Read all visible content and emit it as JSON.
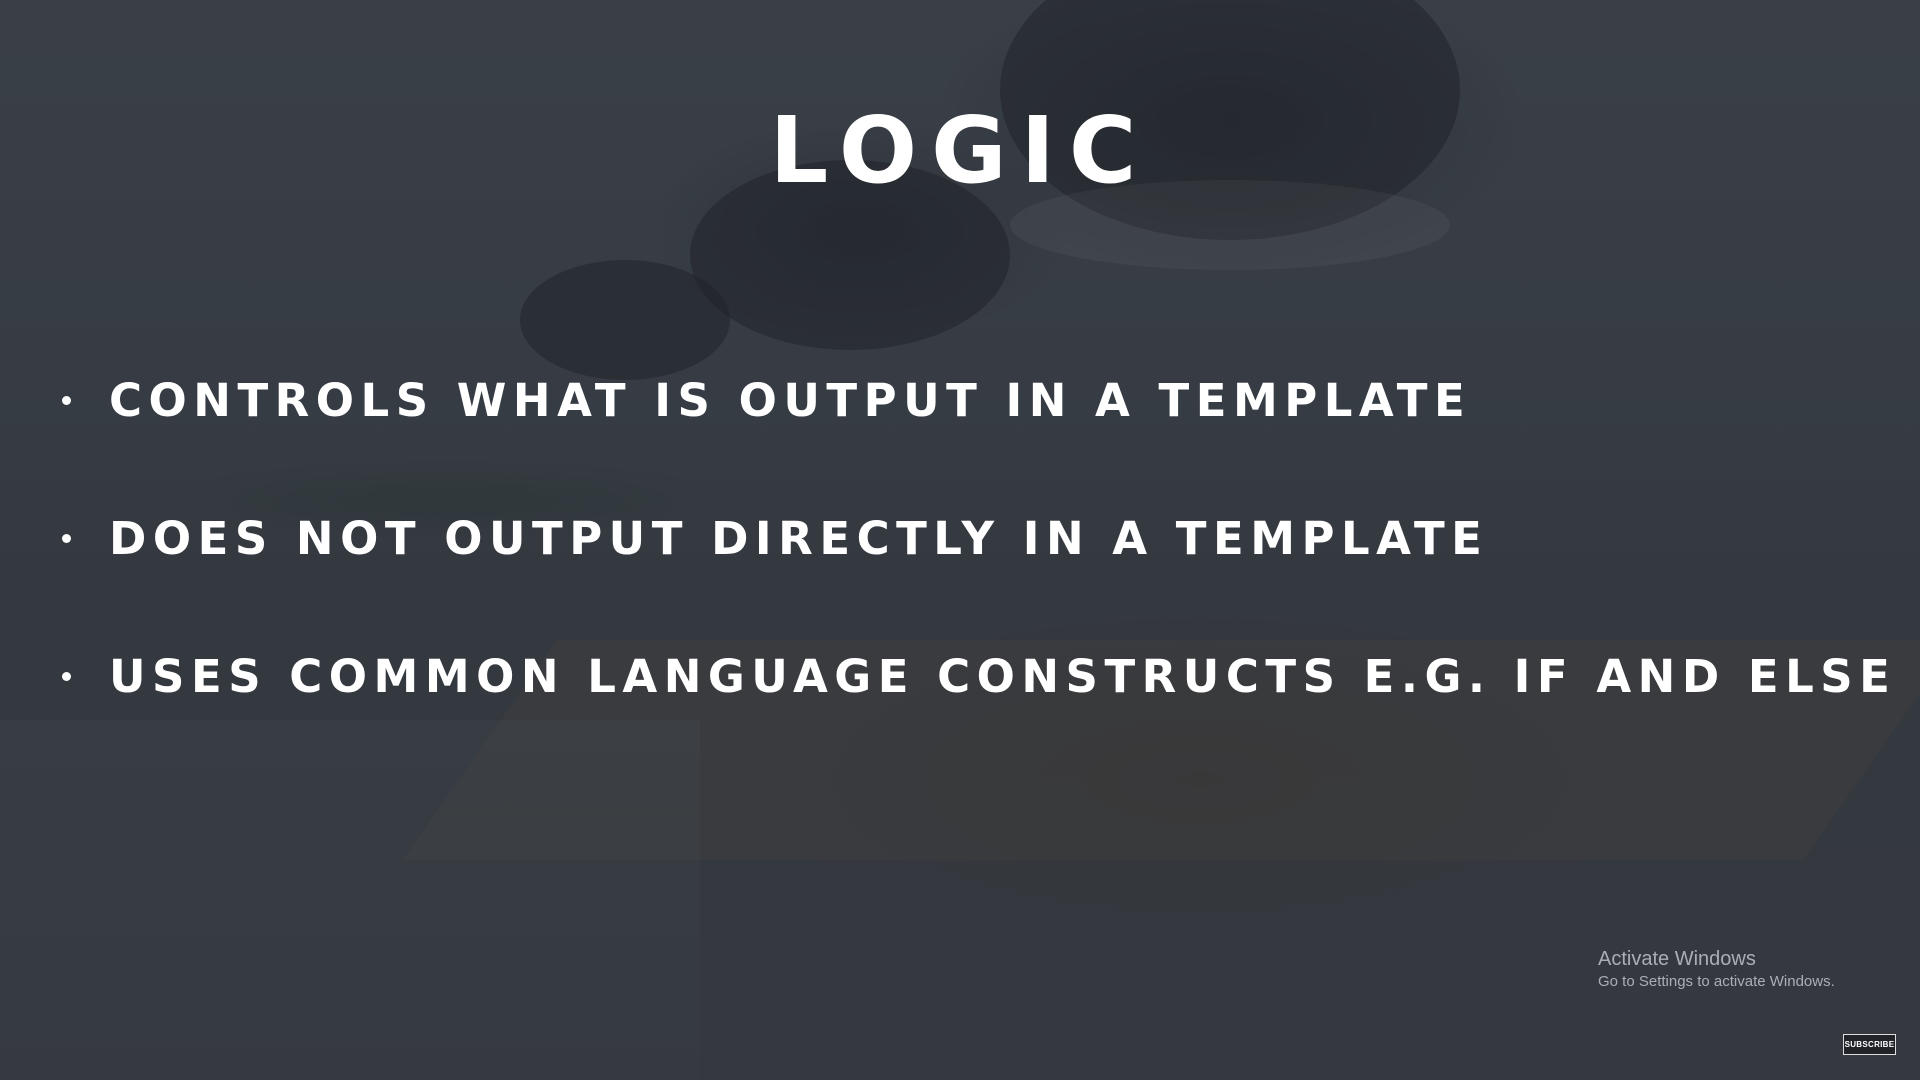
{
  "slide": {
    "title": "LOGIC",
    "bullets": [
      "CONTROLS WHAT IS OUTPUT IN A TEMPLATE",
      "DOES NOT OUTPUT DIRECTLY IN A TEMPLATE",
      "USES COMMON LANGUAGE CONSTRUCTS E.G. IF AND ELSE"
    ]
  },
  "watermark": {
    "title": "Activate Windows",
    "subtitle": "Go to Settings to activate Windows."
  },
  "subscribe_button": {
    "label": "SUBSCRIBE"
  },
  "colors": {
    "text": "#ffffff",
    "overlay": "#1c2026",
    "watermark_text": "#d2d6dc"
  }
}
